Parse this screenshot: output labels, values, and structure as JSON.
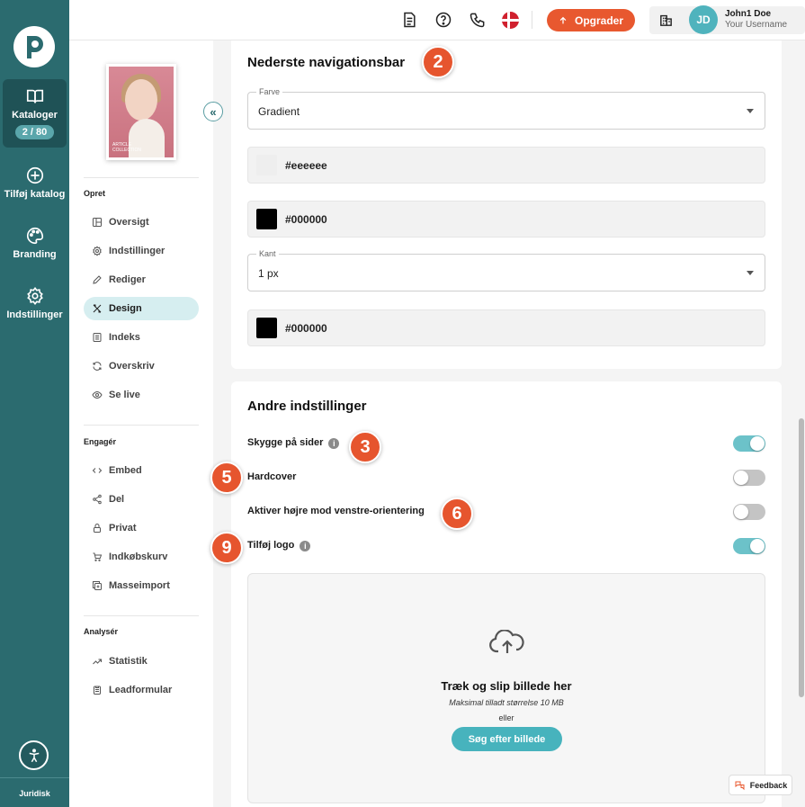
{
  "rail": {
    "items": [
      {
        "label": "Kataloger",
        "badge": "2 / 80"
      },
      {
        "label": "Tilføj katalog"
      },
      {
        "label": "Branding"
      },
      {
        "label": "Indstillinger"
      }
    ],
    "legal": "Juridisk"
  },
  "topbar": {
    "upgrade_label": "Opgrader",
    "avatar_initials": "JD",
    "user_name": "John1 Doe",
    "user_sub": "Your Username"
  },
  "subnav": {
    "cover_text": "ARTICLE COLLECTION",
    "sections": [
      {
        "heading": "Opret",
        "items": [
          "Oversigt",
          "Indstillinger",
          "Rediger",
          "Design",
          "Indeks",
          "Overskriv",
          "Se live"
        ]
      },
      {
        "heading": "Engagér",
        "items": [
          "Embed",
          "Del",
          "Privat",
          "Indkøbskurv",
          "Masseimport"
        ]
      },
      {
        "heading": "Analysér",
        "items": [
          "Statistik",
          "Leadformular"
        ]
      }
    ],
    "active_item": "Design"
  },
  "nav_bar_section": {
    "title": "Nederste navigationsbar",
    "marker": "2",
    "color_select": {
      "label": "Farve",
      "value": "Gradient"
    },
    "color_1": {
      "hex": "#eeeeee",
      "text": "#eeeeee"
    },
    "color_2": {
      "hex": "#000000",
      "text": "#000000"
    },
    "border_select": {
      "label": "Kant",
      "value": "1 px"
    },
    "color_3": {
      "hex": "#000000",
      "text": "#000000"
    }
  },
  "other_section": {
    "title": "Andre indstillinger",
    "toggles": [
      {
        "label": "Skygge på sider",
        "info": true,
        "on": true,
        "marker": "3"
      },
      {
        "label": "Hardcover",
        "info": false,
        "on": false,
        "marker": "5"
      },
      {
        "label": "Aktiver højre mod venstre-orientering",
        "info": false,
        "on": false,
        "marker": "6"
      },
      {
        "label": "Tilføj logo",
        "info": true,
        "on": true,
        "marker": "9"
      }
    ],
    "dropzone": {
      "title": "Træk og slip billede her",
      "subtitle": "Maksimal tilladt størrelse 10 MB",
      "or_text": "eller",
      "button": "Søg efter billede"
    }
  },
  "feedback_label": "Feedback",
  "colors": {
    "rail": "#2b6b6f",
    "accent": "#e8582f",
    "teal": "#47b3bd"
  }
}
